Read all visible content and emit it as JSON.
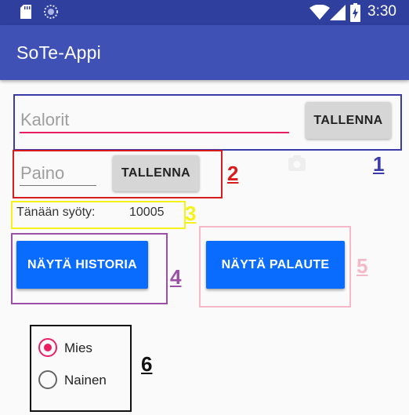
{
  "status_bar": {
    "time": "3:30",
    "icons": [
      "sd-card-icon",
      "sync-icon",
      "wifi-icon",
      "signal-icon",
      "battery-charging-icon"
    ]
  },
  "app_bar": {
    "title": "SoTe-Appi"
  },
  "kalorit": {
    "placeholder": "Kalorit",
    "button_label": "TALLENNA"
  },
  "paino": {
    "placeholder": "Paino",
    "button_label": "TALLENNA"
  },
  "today": {
    "label": "Tänään syöty:",
    "value": "10005"
  },
  "buttons": {
    "history": "NÄYTÄ HISTORIA",
    "feedback": "NÄYTÄ PALAUTE"
  },
  "gender": {
    "options": [
      {
        "label": "Mies",
        "selected": true
      },
      {
        "label": "Nainen",
        "selected": false
      }
    ]
  },
  "annotations": {
    "labels": [
      "1",
      "2",
      "3",
      "4",
      "5",
      "6"
    ],
    "colors": [
      "#3a3aa8",
      "#d81b1b",
      "#f5f21a",
      "#9c4fa6",
      "#f5b8c8",
      "#111111"
    ]
  },
  "colors": {
    "status_bar": "#2f3f9e",
    "app_bar": "#3f51b5",
    "accent": "#e91e63",
    "primary_button": "#0a6cff",
    "secondary_button": "#d6d6d6"
  }
}
